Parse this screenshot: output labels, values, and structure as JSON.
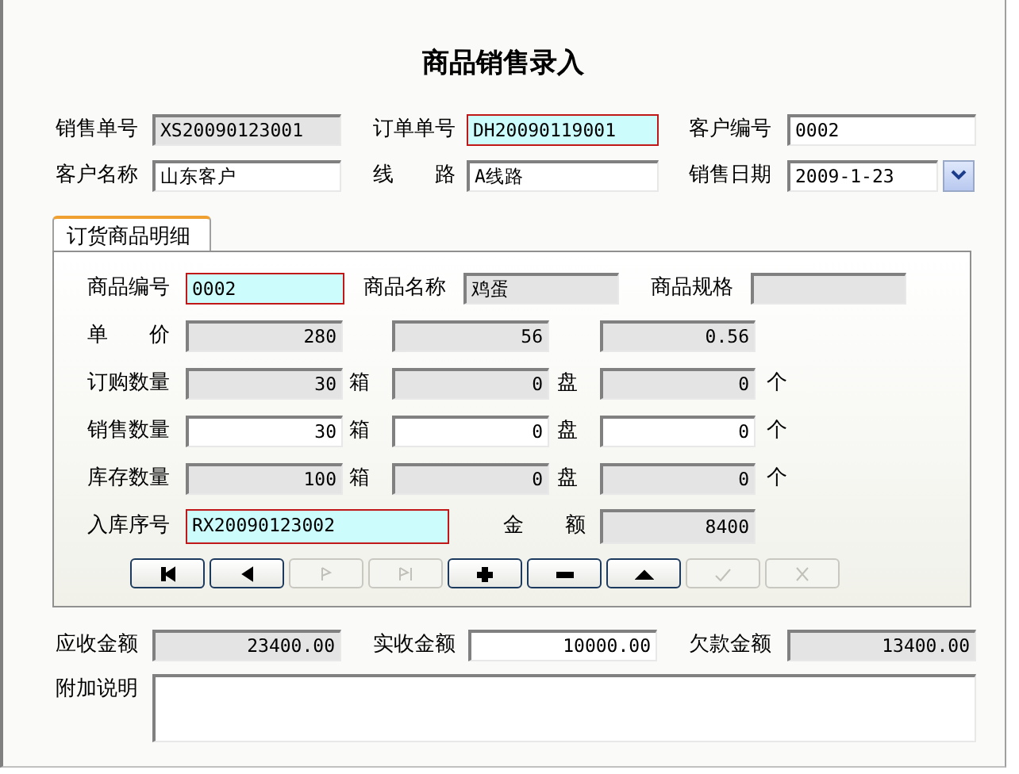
{
  "title": "商品销售录入",
  "header": {
    "rows": [
      {
        "fields": [
          {
            "label": "销售单号",
            "value": "XS20090123001",
            "kind": "text",
            "readonly": true,
            "highlighted": false
          },
          {
            "label": "订单单号",
            "value": "DH20090119001",
            "kind": "text",
            "readonly": false,
            "highlighted": true
          },
          {
            "label": "客户编号",
            "value": "0002",
            "kind": "text",
            "readonly": false,
            "highlighted": false
          }
        ]
      },
      {
        "fields": [
          {
            "label": "客户名称",
            "value": "山东客户",
            "kind": "text",
            "readonly": false,
            "highlighted": false
          },
          {
            "label": "线　　路",
            "value": "A线路",
            "kind": "text",
            "readonly": false,
            "highlighted": false
          },
          {
            "label": "销售日期",
            "value": "2009-1-23",
            "kind": "date",
            "readonly": false,
            "highlighted": false
          }
        ]
      }
    ]
  },
  "tabs": [
    {
      "label": "订货商品明细",
      "selected": true
    }
  ],
  "detail": {
    "rows": [
      {
        "cells": [
          {
            "kind": "label",
            "text": "商品编号"
          },
          {
            "kind": "text-field",
            "value": "0002",
            "readonly": false,
            "highlighted": true
          },
          {
            "kind": "label",
            "text": "商品名称"
          },
          {
            "kind": "text-field",
            "value": "鸡蛋",
            "readonly": true,
            "highlighted": false
          },
          {
            "kind": "label",
            "text": "商品规格"
          },
          {
            "kind": "text-field",
            "readonly": true,
            "highlighted": false
          }
        ]
      },
      {
        "cells": [
          {
            "kind": "label",
            "text": "单　　价"
          },
          {
            "kind": "number-field",
            "value": "280",
            "readonly": true,
            "highlighted": false
          },
          {
            "kind": "number-field",
            "value": "56",
            "readonly": true,
            "highlighted": false
          },
          {
            "kind": "number-field",
            "value": "0.56",
            "readonly": true,
            "highlighted": false
          }
        ]
      },
      {
        "cells": [
          {
            "kind": "label",
            "text": "订购数量"
          },
          {
            "kind": "number-field",
            "value": "30",
            "readonly": true,
            "highlighted": false
          },
          {
            "kind": "unit",
            "text": "箱"
          },
          {
            "kind": "number-field",
            "value": "0",
            "readonly": true,
            "highlighted": false
          },
          {
            "kind": "unit",
            "text": "盘"
          },
          {
            "kind": "number-field",
            "value": "0",
            "readonly": true,
            "highlighted": false
          },
          {
            "kind": "unit",
            "text": "个"
          }
        ]
      },
      {
        "cells": [
          {
            "kind": "label",
            "text": "销售数量"
          },
          {
            "kind": "number-field",
            "value": "30",
            "readonly": false,
            "highlighted": false
          },
          {
            "kind": "unit",
            "text": "箱"
          },
          {
            "kind": "number-field",
            "value": "0",
            "readonly": false,
            "highlighted": false
          },
          {
            "kind": "unit",
            "text": "盘"
          },
          {
            "kind": "number-field",
            "value": "0",
            "readonly": false,
            "highlighted": false
          },
          {
            "kind": "unit",
            "text": "个"
          }
        ]
      },
      {
        "cells": [
          {
            "kind": "label",
            "text": "库存数量"
          },
          {
            "kind": "number-field",
            "value": "100",
            "readonly": true,
            "highlighted": false
          },
          {
            "kind": "unit",
            "text": "箱"
          },
          {
            "kind": "number-field",
            "value": "0",
            "readonly": true,
            "highlighted": false
          },
          {
            "kind": "unit",
            "text": "盘"
          },
          {
            "kind": "number-field",
            "value": "0",
            "readonly": true,
            "highlighted": false
          },
          {
            "kind": "unit",
            "text": "个"
          }
        ]
      },
      {
        "cells": [
          {
            "kind": "label",
            "text": "入库序号"
          },
          {
            "kind": "text-field",
            "value": "RX20090123002",
            "readonly": false,
            "highlighted": true
          },
          {
            "kind": "label",
            "text": "金　　额"
          },
          {
            "kind": "number-field",
            "value": "8400",
            "readonly": true,
            "highlighted": false
          }
        ]
      }
    ],
    "buttons": [
      {
        "kind": "first",
        "disabled": false
      },
      {
        "kind": "previous",
        "disabled": false
      },
      {
        "kind": "next",
        "disabled": true
      },
      {
        "kind": "last",
        "disabled": true
      },
      {
        "kind": "add",
        "disabled": false
      },
      {
        "kind": "delete",
        "disabled": false
      },
      {
        "kind": "up",
        "disabled": false
      },
      {
        "kind": "save",
        "disabled": true
      },
      {
        "kind": "cancel",
        "disabled": true
      }
    ]
  },
  "totals": [
    {
      "label": "应收金额",
      "value": "23400.00",
      "readonly": true
    },
    {
      "label": "实收金额",
      "value": "10000.00",
      "readonly": false
    },
    {
      "label": "欠款金额",
      "value": "13400.00",
      "readonly": true
    }
  ],
  "note": {
    "label": "附加说明"
  }
}
